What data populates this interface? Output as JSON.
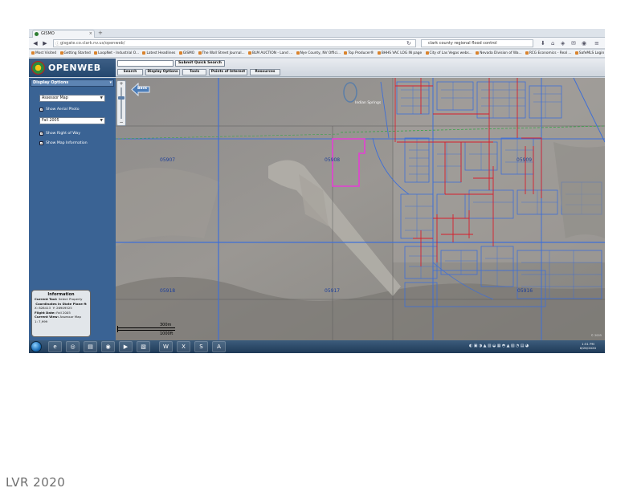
{
  "browser": {
    "tab_title": "GISMO",
    "url": "gisgate.co.clark.nv.us/openweb/",
    "search_query": "clark county regional flood control",
    "bookmarks": [
      "Most Visited",
      "Getting Started",
      "LoopNet - Industrial O...",
      "Latest Headlines",
      "GISMO",
      "The Wall Street Journal...",
      "BLM AUCTION - Land ...",
      "Nye County, NV Offici...",
      "Top Producer®",
      "BHHS VAC LOG IN page",
      "City of Las Vegas webs...",
      "Nevada Division of Wa...",
      "RCG Economics - Real ...",
      "SafeMLS Login"
    ]
  },
  "app": {
    "logo": "OPENWEB",
    "quick_search_button": "Submit Quick Search",
    "tabs": [
      "Search",
      "Display Options",
      "Tools",
      "Points of Interest",
      "Resources"
    ]
  },
  "panel": {
    "title": "Display Options",
    "map_type": "Assessor Map",
    "show_aerial": "Show Aerial Photo",
    "flight": "Fall 2005",
    "show_rightofway": "Show Right of Way",
    "show_mapinfo": "Show Map Information"
  },
  "info": {
    "title": "Information",
    "current_tool_label": "Current Tool:",
    "current_tool_value": "Select Property",
    "coords_label": "Coordinates in State Plane ft",
    "x": "X: 828413",
    "y": "Y: 26909525",
    "flight_label": "Flight Date:",
    "flight_value": "Fall 2005",
    "view_label": "Current View:",
    "view_value": "Assessor Map",
    "scale": "1: 7,999"
  },
  "map": {
    "back_label": "Back",
    "parcels": [
      "05907",
      "05908",
      "05909",
      "05918",
      "05917",
      "05916"
    ],
    "place_label": "Indian Springs",
    "scale_m": "300m",
    "scale_ft": "1000ft",
    "copyright": "© 2005"
  },
  "taskbar": {
    "time": "1:51 PM",
    "date": "6/26/2020"
  },
  "watermark": "LVR 2020",
  "colors": {
    "parcel_lines": "#3f6fd6",
    "street_lines": "#d81e2c",
    "selected_parcel": "#e43ed4",
    "panel_bg": "#3a6394"
  }
}
